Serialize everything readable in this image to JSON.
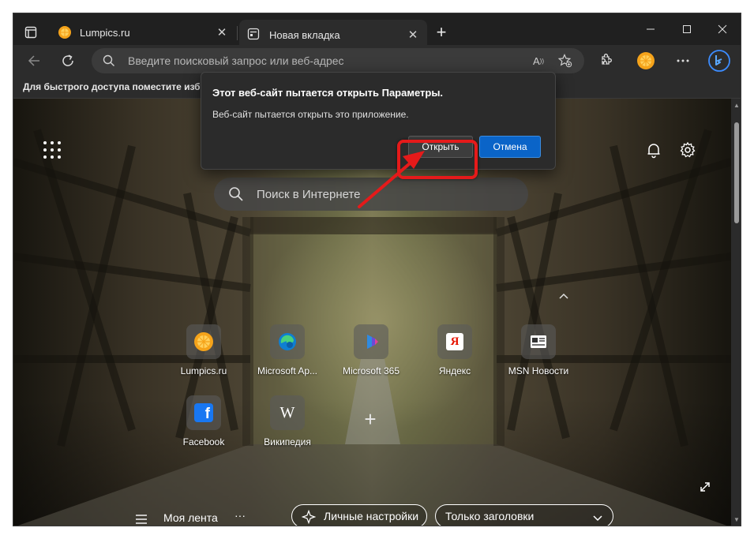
{
  "tabs": [
    {
      "title": "Lumpics.ru",
      "favicon": "lumpics-orange-icon",
      "active": false
    },
    {
      "title": "Новая вкладка",
      "favicon": "new-tab-page-icon",
      "active": true
    }
  ],
  "address_bar": {
    "placeholder": "Введите поисковый запрос или веб-адрес"
  },
  "favorites_bar": {
    "text": "Для быстрого доступа поместите избра"
  },
  "dialog": {
    "title": "Этот веб-сайт пытается открыть Параметры.",
    "message": "Веб-сайт пытается открыть это приложение.",
    "open_label": "Открыть",
    "cancel_label": "Отмена"
  },
  "new_tab": {
    "search_placeholder": "Поиск в Интернете",
    "quick_links": [
      {
        "label": "Lumpics.ru",
        "icon": "lumpics-orange-icon"
      },
      {
        "label": "Microsoft Ap...",
        "icon": "edge-icon"
      },
      {
        "label": "Microsoft 365",
        "icon": "microsoft-365-icon"
      },
      {
        "label": "Яндекс",
        "icon": "yandex-icon"
      },
      {
        "label": "MSN Новости",
        "icon": "msn-news-icon"
      },
      {
        "label": "Facebook",
        "icon": "facebook-icon"
      },
      {
        "label": "Википедия",
        "icon": "wikipedia-icon"
      }
    ],
    "feed": {
      "title": "Моя лента",
      "personal_settings": "Личные настройки",
      "headlines_only": "Только заголовки",
      "more": "···"
    }
  },
  "colors": {
    "accent": "#0a64c8",
    "highlight_red": "#e51a1a",
    "lumpics_orange": "#f5a31a",
    "facebook_blue": "#1877f2"
  }
}
